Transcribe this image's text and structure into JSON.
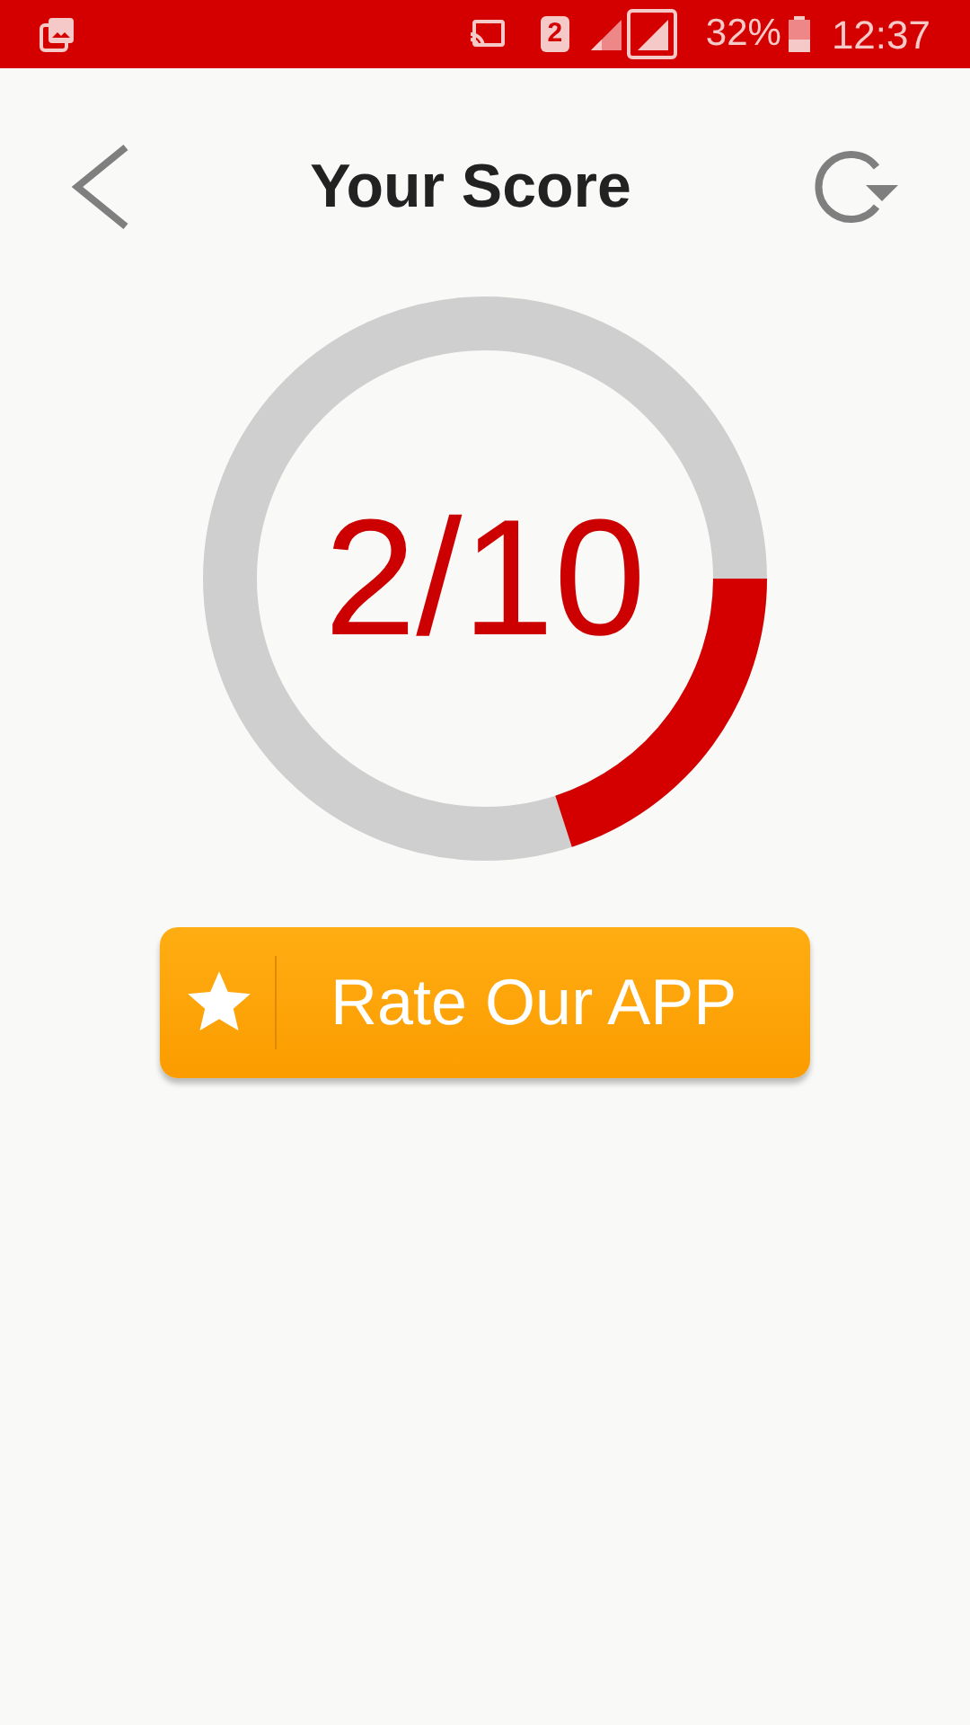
{
  "status_bar": {
    "sim": "2",
    "battery": "32%",
    "time": "12:37"
  },
  "header": {
    "title": "Your Score"
  },
  "score": {
    "text": "2/10",
    "level": 0.2
  },
  "rate_button": {
    "label": "Rate Our APP"
  }
}
